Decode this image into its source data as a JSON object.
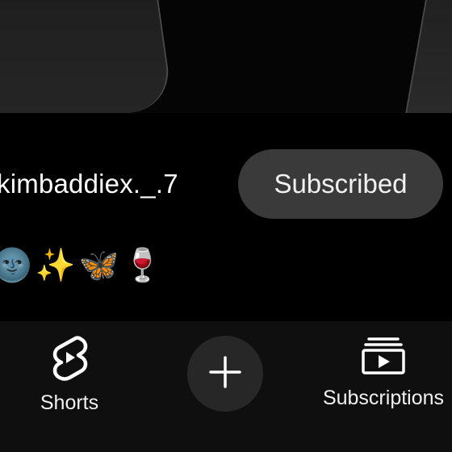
{
  "channel": {
    "name": "kimbaddiex._.7",
    "subscribe_label": "Subscribed",
    "bio_emojis": [
      "🌚",
      "✨",
      "🦋",
      "🍷"
    ]
  },
  "bottom_nav": {
    "shorts_label": "Shorts",
    "create_icon": "plus-icon",
    "subscriptions_label": "Subscriptions"
  },
  "colors": {
    "background": "#000000",
    "subscribed_button": "#3a3a3a",
    "nav_background": "#0f0f0f",
    "create_button": "#272727"
  }
}
